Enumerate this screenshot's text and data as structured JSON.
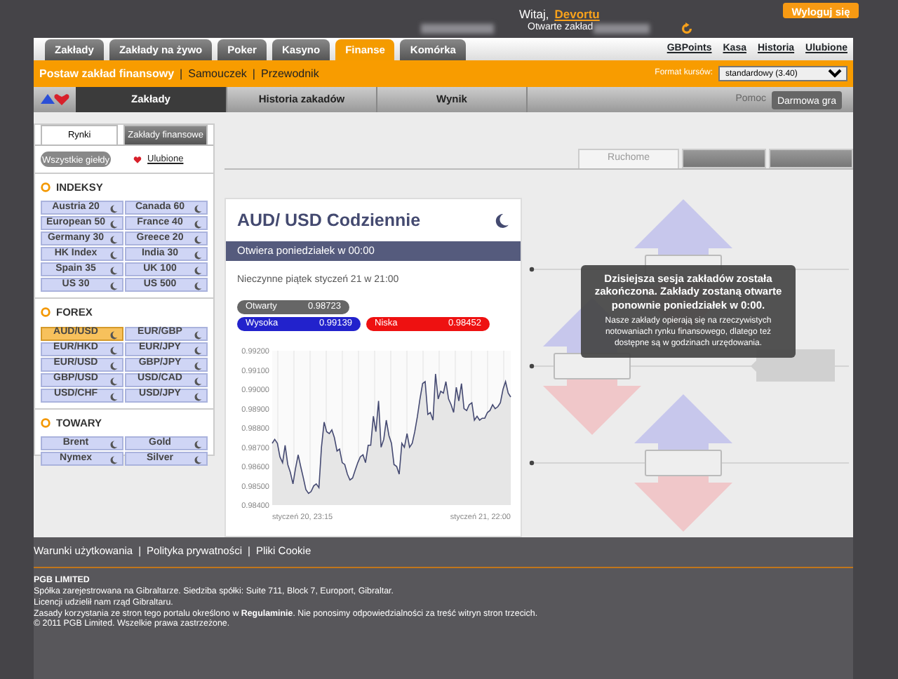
{
  "header": {
    "greeting": "Witaj,",
    "user": "Devortu",
    "logout": "Wyloguj się",
    "open_bets": "Otwarte zakład"
  },
  "main_tabs": [
    {
      "label": "Zakłady",
      "selected": false
    },
    {
      "label": "Zakłady na żywo",
      "selected": false
    },
    {
      "label": "Poker",
      "selected": false
    },
    {
      "label": "Kasyno",
      "selected": false
    },
    {
      "label": "Finanse",
      "selected": true
    },
    {
      "label": "Komórka",
      "selected": false
    }
  ],
  "top_links": [
    "GBPoints",
    "Kasa",
    "Historia",
    "Ulubione"
  ],
  "separator": "|",
  "sub_links": [
    {
      "label": "Postaw zakład finansowy",
      "selected": true
    },
    {
      "label": "Samouczek",
      "selected": false
    },
    {
      "label": "Przewodnik",
      "selected": false
    }
  ],
  "odds_format": {
    "label": "Format kursów:",
    "value": "standardowy (3.40)"
  },
  "nav_tabs": [
    {
      "label": "Zakłady",
      "selected": true
    },
    {
      "label": "Historia zakadów",
      "selected": false
    },
    {
      "label": "Wynik",
      "selected": false
    }
  ],
  "help": "Pomoc",
  "demo_button": "Darmowa gra",
  "sidebar": {
    "tabs": [
      {
        "label": "Rynki",
        "selected": true
      },
      {
        "label": "Zakłady finansowe",
        "selected": false
      }
    ],
    "filters": [
      {
        "label": "Wszystkie giełdy",
        "selected": true
      },
      {
        "label": "Ulubione",
        "selected": false
      }
    ],
    "groups": [
      {
        "title": "INDEKSY",
        "items": [
          {
            "label": "Austria 20",
            "selected": false
          },
          {
            "label": "Canada 60",
            "selected": false
          },
          {
            "label": "European 50",
            "selected": false
          },
          {
            "label": "France 40",
            "selected": false
          },
          {
            "label": "Germany 30",
            "selected": false
          },
          {
            "label": "Greece 20",
            "selected": false
          },
          {
            "label": "HK Index",
            "selected": false
          },
          {
            "label": "India 30",
            "selected": false
          },
          {
            "label": "Spain 35",
            "selected": false
          },
          {
            "label": "UK 100",
            "selected": false
          },
          {
            "label": "US 30",
            "selected": false
          },
          {
            "label": "US 500",
            "selected": false
          }
        ]
      },
      {
        "title": "FOREX",
        "items": [
          {
            "label": "AUD/USD",
            "selected": true
          },
          {
            "label": "EUR/GBP",
            "selected": false
          },
          {
            "label": "EUR/HKD",
            "selected": false
          },
          {
            "label": "EUR/JPY",
            "selected": false
          },
          {
            "label": "EUR/USD",
            "selected": false
          },
          {
            "label": "GBP/JPY",
            "selected": false
          },
          {
            "label": "GBP/USD",
            "selected": false
          },
          {
            "label": "USD/CAD",
            "selected": false
          },
          {
            "label": "USD/CHF",
            "selected": false
          },
          {
            "label": "USD/JPY",
            "selected": false
          }
        ]
      },
      {
        "title": "TOWARY",
        "items": [
          {
            "label": "Brent",
            "selected": false
          },
          {
            "label": "Gold",
            "selected": false
          },
          {
            "label": "Nymex",
            "selected": false
          },
          {
            "label": "Silver",
            "selected": false
          }
        ]
      }
    ]
  },
  "market": {
    "title": "AUD/ USD Codziennie",
    "opens": "Otwiera poniedziałek w 00:00",
    "closed": "Nieczynne piątek styczeń 21 w 21:00",
    "stats": [
      {
        "kind": "open",
        "label": "Otwarty",
        "value": "0.98723"
      },
      {
        "kind": "high",
        "label": "Wysoka",
        "value": "0.99139"
      },
      {
        "kind": "low",
        "label": "Niska",
        "value": "0.98452"
      }
    ],
    "axis_start": "styczeń 20, 23:15",
    "axis_end": "styczeń 21, 22:00",
    "chart_data": {
      "type": "area",
      "ylim": [
        0.984,
        0.992
      ],
      "yticks": [
        {
          "value": 0.984,
          "label": "0.98400"
        },
        {
          "value": 0.985,
          "label": "0.98500"
        },
        {
          "value": 0.986,
          "label": "0.98600"
        },
        {
          "value": 0.987,
          "label": "0.98700"
        },
        {
          "value": 0.988,
          "label": "0.98800"
        },
        {
          "value": 0.989,
          "label": "0.98900"
        },
        {
          "value": 0.99,
          "label": "0.99000"
        },
        {
          "value": 0.991,
          "label": "0.99100"
        },
        {
          "value": 0.992,
          "label": "0.99200"
        }
      ],
      "series": [
        {
          "color": "#454a72",
          "values": [
            0.9872,
            0.9874,
            0.9872,
            0.9865,
            0.9862,
            0.9871,
            0.9861,
            0.9857,
            0.9851,
            0.9859,
            0.9866,
            0.986,
            0.9854,
            0.9848,
            0.9846,
            0.9847,
            0.985,
            0.9851,
            0.9849,
            0.987,
            0.9883,
            0.9878,
            0.9877,
            0.9879,
            0.9875,
            0.9868,
            0.9869,
            0.9862,
            0.9861,
            0.9856,
            0.9853,
            0.9854,
            0.9858,
            0.9862,
            0.9865,
            0.9866,
            0.9862,
            0.9871,
            0.9871,
            0.9886,
            0.9878,
            0.9894,
            0.987,
            0.9874,
            0.9884,
            0.9876,
            0.9872,
            0.9861,
            0.986,
            0.9856,
            0.9872,
            0.987,
            0.9877,
            0.987,
            0.9872,
            0.9878,
            0.9886,
            0.9895,
            0.9903,
            0.9904,
            0.9887,
            0.9888,
            0.9884,
            0.9908,
            0.9895,
            0.9899,
            0.9898,
            0.9904,
            0.9895,
            0.9892,
            0.9888,
            0.9901,
            0.9894,
            0.9903,
            0.989,
            0.9889,
            0.9892,
            0.9893,
            0.9884,
            0.9886,
            0.9884,
            0.9885,
            0.9885,
            0.9888,
            0.9889,
            0.9892,
            0.989,
            0.9891,
            0.9893,
            0.99,
            0.9904,
            0.9898,
            0.9896
          ]
        }
      ]
    }
  },
  "panel_tabs": [
    {
      "label": "Ruchome",
      "selected": true
    },
    {
      "selected": false
    },
    {
      "selected": false
    }
  ],
  "tooltip": {
    "title": "Dzisiejsza sesja zakładów została zakończona. Zakłady zostaną otwarte ponownie poniedziałek w 0:00.",
    "body": "Nasze zakłady opierają się na rzeczywistych notowaniach rynku finansowego, dlatego też dostępne są w godzinach urzędowania."
  },
  "footer": {
    "links": [
      "Warunki użytkowania",
      "Polityka prywatności",
      "Pliki Cookie"
    ],
    "lines": [
      "PGB LIMITED",
      "Spółka zarejestrowana na Gibraltarze. Siedziba spółki: Suite 711, Block 7, Europort, Gibraltar.",
      "Licencji udzielił nam rząd Gibraltaru.",
      "Zasady korzystania ze stron tego portalu określono w **Regulaminie**. Nie ponosimy odpowiedzialności za treść witryn stron trzecich.",
      "© 2011 PGB Limited. Wszelkie prawa zastrzeżone."
    ]
  }
}
